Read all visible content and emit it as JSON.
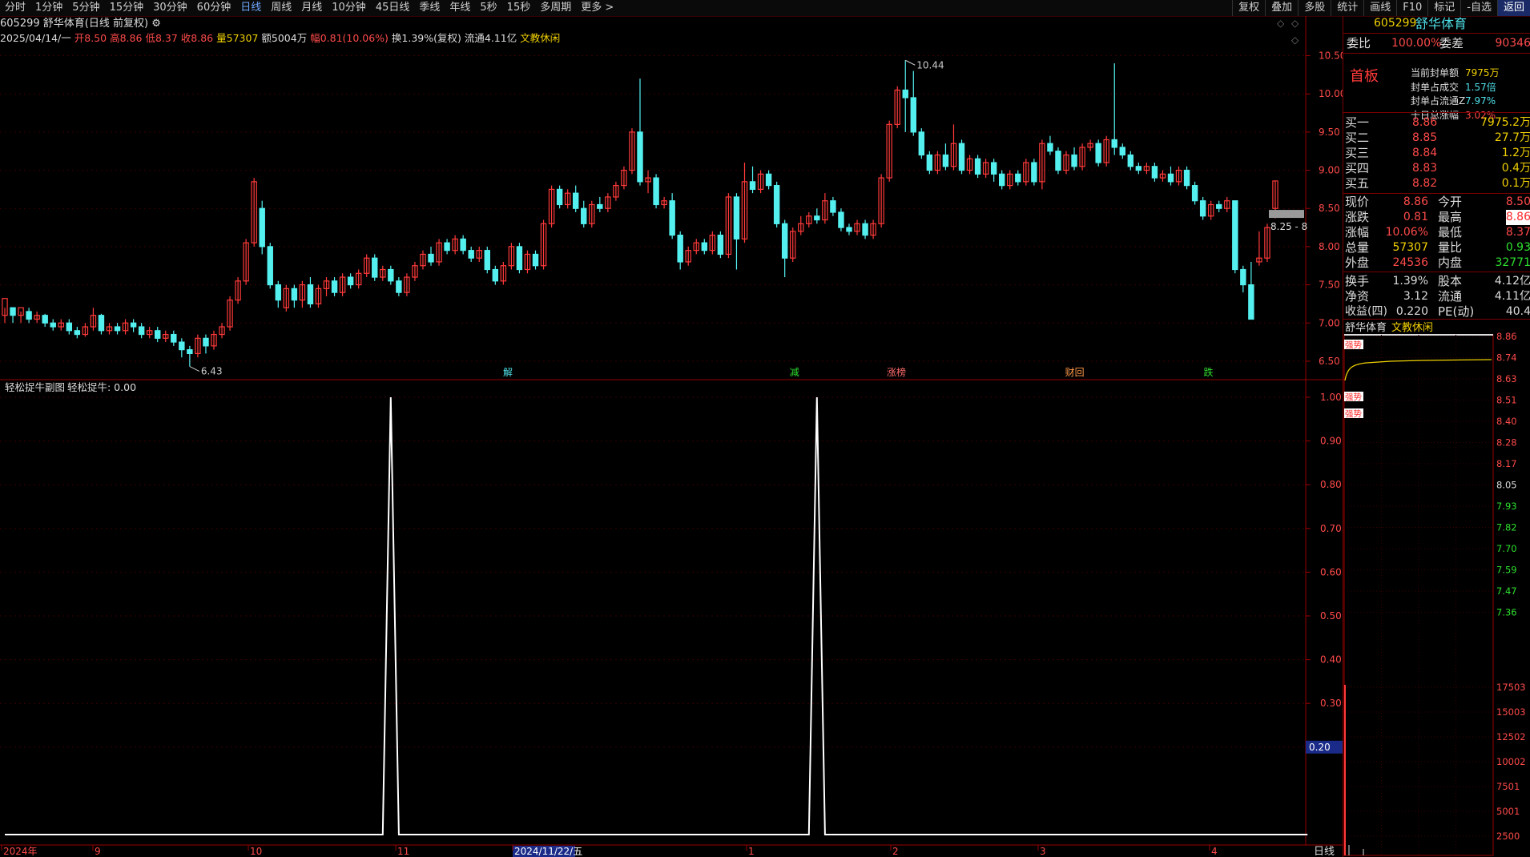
{
  "toolbar": {
    "periods": [
      "分时",
      "1分钟",
      "5分钟",
      "15分钟",
      "30分钟",
      "60分钟",
      "日线",
      "周线",
      "月线",
      "10分钟",
      "45日线",
      "季线",
      "年线",
      "5秒",
      "15秒",
      "多周期",
      "更多 >"
    ],
    "active_period": "日线",
    "tools": [
      "复权",
      "叠加",
      "多股",
      "统计",
      "画线",
      "F10",
      "标记",
      "-自选",
      "返回"
    ]
  },
  "chart_header": {
    "title_code": "605299",
    "title_name": "舒华体育(日线 前复权)",
    "date": "2025/04/14/一",
    "open_label": "开",
    "open": "8.50",
    "high_label": "高",
    "high": "8.86",
    "low_label": "低",
    "low": "8.37",
    "close_label": "收",
    "close": "8.86",
    "vol_label": "量",
    "vol": "57307",
    "amount": "额5004万",
    "change": "幅0.81(10.06%)",
    "turnover": "换1.39%(复权)",
    "float": "流通4.11亿",
    "sector": "文教休闲"
  },
  "chart_data": [
    {
      "type": "candlestick",
      "name": "main-kline",
      "ylim": [
        6.3,
        10.6
      ],
      "y_ticks": [
        "10.50",
        "10.00",
        "9.50",
        "9.00",
        "8.50",
        "8.00",
        "7.50",
        "7.00",
        "6.50"
      ],
      "annotations": {
        "high": "10.44",
        "low": "6.43",
        "last_box": "8.25 - 8"
      },
      "event_markers": [
        "解",
        "减",
        "涨榜",
        "财回",
        "跌"
      ],
      "candles": [
        [
          7.1,
          7.32,
          7.0,
          7.2
        ],
        [
          7.2,
          7.1,
          7.0,
          7.15
        ],
        [
          7.1,
          7.2,
          7.0,
          7.15
        ],
        [
          7.15,
          7.05,
          7.0,
          7.2
        ],
        [
          7.05,
          7.1,
          7.0,
          7.15
        ],
        [
          7.1,
          7.0,
          6.95,
          7.12
        ],
        [
          7.0,
          6.95,
          6.9,
          7.05
        ],
        [
          6.95,
          7.0,
          6.9,
          7.05
        ],
        [
          7.0,
          6.9,
          6.85,
          7.05
        ],
        [
          6.9,
          6.85,
          6.8,
          6.95
        ],
        [
          6.85,
          6.95,
          6.82,
          7.0
        ],
        [
          6.95,
          7.1,
          6.9,
          7.2
        ],
        [
          7.1,
          6.9,
          6.85,
          7.12
        ],
        [
          6.9,
          6.95,
          6.85,
          7.0
        ],
        [
          6.95,
          6.9,
          6.85,
          7.0
        ],
        [
          6.9,
          7.0,
          6.85,
          7.05
        ],
        [
          7.0,
          6.95,
          6.88,
          7.05
        ],
        [
          6.95,
          6.85,
          6.8,
          7.0
        ],
        [
          6.85,
          6.9,
          6.8,
          6.95
        ],
        [
          6.9,
          6.8,
          6.75,
          6.95
        ],
        [
          6.8,
          6.85,
          6.75,
          6.9
        ],
        [
          6.85,
          6.75,
          6.7,
          6.9
        ],
        [
          6.75,
          6.65,
          6.55,
          6.8
        ],
        [
          6.65,
          6.6,
          6.43,
          6.7
        ],
        [
          6.6,
          6.8,
          6.55,
          6.85
        ],
        [
          6.8,
          6.7,
          6.6,
          6.85
        ],
        [
          6.7,
          6.85,
          6.65,
          6.9
        ],
        [
          6.85,
          6.95,
          6.8,
          7.0
        ],
        [
          6.95,
          7.3,
          6.9,
          7.35
        ],
        [
          7.3,
          7.55,
          7.25,
          7.6
        ],
        [
          7.55,
          8.05,
          7.5,
          8.1
        ],
        [
          8.05,
          8.85,
          8.0,
          8.9
        ],
        [
          8.5,
          8.0,
          7.9,
          8.6
        ],
        [
          8.0,
          7.5,
          7.45,
          8.05
        ],
        [
          7.5,
          7.3,
          7.2,
          7.55
        ],
        [
          7.2,
          7.45,
          7.15,
          7.5
        ],
        [
          7.45,
          7.3,
          7.2,
          7.5
        ],
        [
          7.3,
          7.5,
          7.2,
          7.55
        ],
        [
          7.5,
          7.25,
          7.2,
          7.6
        ],
        [
          7.25,
          7.45,
          7.2,
          7.5
        ],
        [
          7.45,
          7.55,
          7.35,
          7.6
        ],
        [
          7.55,
          7.4,
          7.35,
          7.6
        ],
        [
          7.4,
          7.6,
          7.35,
          7.65
        ],
        [
          7.6,
          7.5,
          7.45,
          7.65
        ],
        [
          7.5,
          7.65,
          7.45,
          7.7
        ],
        [
          7.65,
          7.85,
          7.6,
          7.9
        ],
        [
          7.85,
          7.6,
          7.55,
          7.9
        ],
        [
          7.6,
          7.7,
          7.55,
          7.75
        ],
        [
          7.7,
          7.55,
          7.5,
          7.75
        ],
        [
          7.55,
          7.4,
          7.35,
          7.6
        ],
        [
          7.4,
          7.6,
          7.35,
          7.65
        ],
        [
          7.6,
          7.75,
          7.55,
          7.8
        ],
        [
          7.75,
          7.9,
          7.7,
          7.95
        ],
        [
          7.9,
          7.8,
          7.75,
          8.0
        ],
        [
          7.8,
          8.05,
          7.75,
          8.1
        ],
        [
          8.05,
          7.95,
          7.9,
          8.1
        ],
        [
          7.95,
          8.1,
          7.9,
          8.15
        ],
        [
          8.1,
          7.95,
          7.9,
          8.15
        ],
        [
          7.95,
          7.85,
          7.8,
          8.0
        ],
        [
          7.85,
          7.95,
          7.8,
          8.0
        ],
        [
          7.95,
          7.7,
          7.65,
          8.0
        ],
        [
          7.7,
          7.55,
          7.5,
          7.75
        ],
        [
          7.55,
          7.75,
          7.5,
          7.8
        ],
        [
          7.75,
          8.0,
          7.7,
          8.05
        ],
        [
          8.0,
          7.7,
          7.65,
          8.05
        ],
        [
          7.7,
          7.9,
          7.65,
          7.95
        ],
        [
          7.9,
          7.75,
          7.7,
          7.95
        ],
        [
          7.75,
          8.3,
          7.7,
          8.35
        ],
        [
          8.3,
          8.75,
          8.25,
          8.8
        ],
        [
          8.75,
          8.55,
          8.5,
          8.8
        ],
        [
          8.55,
          8.7,
          8.5,
          8.75
        ],
        [
          8.7,
          8.5,
          8.45,
          8.8
        ],
        [
          8.5,
          8.3,
          8.25,
          8.6
        ],
        [
          8.3,
          8.55,
          8.25,
          8.6
        ],
        [
          8.55,
          8.5,
          8.45,
          8.65
        ],
        [
          8.5,
          8.65,
          8.45,
          8.7
        ],
        [
          8.65,
          8.8,
          8.6,
          8.85
        ],
        [
          8.8,
          9.0,
          8.75,
          9.05
        ],
        [
          9.0,
          9.5,
          8.95,
          9.55
        ],
        [
          9.5,
          8.85,
          8.8,
          10.2
        ],
        [
          8.85,
          8.9,
          8.7,
          9.0
        ],
        [
          8.9,
          8.55,
          8.5,
          8.95
        ],
        [
          8.55,
          8.6,
          8.5,
          8.65
        ],
        [
          8.6,
          8.15,
          8.1,
          8.7
        ],
        [
          8.15,
          7.8,
          7.7,
          8.2
        ],
        [
          7.8,
          7.95,
          7.75,
          8.0
        ],
        [
          7.95,
          8.05,
          7.9,
          8.1
        ],
        [
          8.05,
          7.95,
          7.9,
          8.1
        ],
        [
          7.95,
          8.15,
          7.9,
          8.2
        ],
        [
          8.15,
          7.9,
          7.85,
          8.2
        ],
        [
          7.9,
          8.65,
          7.85,
          8.7
        ],
        [
          8.65,
          8.1,
          7.7,
          8.7
        ],
        [
          8.1,
          8.85,
          8.05,
          9.1
        ],
        [
          8.85,
          8.75,
          8.7,
          9.05
        ],
        [
          8.75,
          8.95,
          8.7,
          9.0
        ],
        [
          8.95,
          8.8,
          8.75,
          9.0
        ],
        [
          8.8,
          8.3,
          8.25,
          8.85
        ],
        [
          8.3,
          7.85,
          7.6,
          8.35
        ],
        [
          7.85,
          8.2,
          7.8,
          8.25
        ],
        [
          8.2,
          8.3,
          8.15,
          8.4
        ],
        [
          8.3,
          8.4,
          8.25,
          8.45
        ],
        [
          8.4,
          8.35,
          8.3,
          8.5
        ],
        [
          8.35,
          8.6,
          8.3,
          8.7
        ],
        [
          8.6,
          8.45,
          8.4,
          8.65
        ],
        [
          8.45,
          8.25,
          8.2,
          8.5
        ],
        [
          8.25,
          8.2,
          8.15,
          8.3
        ],
        [
          8.2,
          8.3,
          8.15,
          8.35
        ],
        [
          8.3,
          8.15,
          8.1,
          8.35
        ],
        [
          8.15,
          8.3,
          8.1,
          8.35
        ],
        [
          8.3,
          8.9,
          8.25,
          8.95
        ],
        [
          8.9,
          9.6,
          8.85,
          9.65
        ],
        [
          9.6,
          10.05,
          9.55,
          10.1
        ],
        [
          10.05,
          9.95,
          9.5,
          10.44
        ],
        [
          9.95,
          9.5,
          9.45,
          10.3
        ],
        [
          9.5,
          9.2,
          9.15,
          9.55
        ],
        [
          9.2,
          9.0,
          8.95,
          9.25
        ],
        [
          9.0,
          9.2,
          8.95,
          9.25
        ],
        [
          9.2,
          9.05,
          9.0,
          9.35
        ],
        [
          9.05,
          9.35,
          9.0,
          9.6
        ],
        [
          9.35,
          9.0,
          8.95,
          9.4
        ],
        [
          9.0,
          9.15,
          8.95,
          9.2
        ],
        [
          9.15,
          8.95,
          8.9,
          9.2
        ],
        [
          8.95,
          9.1,
          8.9,
          9.15
        ],
        [
          9.1,
          8.95,
          8.85,
          9.15
        ],
        [
          8.95,
          8.8,
          8.75,
          9.0
        ],
        [
          8.8,
          8.95,
          8.75,
          9.0
        ],
        [
          8.95,
          8.85,
          8.8,
          9.0
        ],
        [
          8.85,
          9.1,
          8.8,
          9.15
        ],
        [
          9.1,
          8.85,
          8.8,
          9.15
        ],
        [
          8.85,
          9.35,
          8.75,
          9.4
        ],
        [
          9.35,
          9.25,
          9.2,
          9.45
        ],
        [
          9.25,
          9.0,
          8.95,
          9.3
        ],
        [
          9.0,
          9.2,
          8.95,
          9.25
        ],
        [
          9.2,
          9.05,
          9.0,
          9.3
        ],
        [
          9.05,
          9.3,
          9.0,
          9.35
        ],
        [
          9.3,
          9.35,
          9.25,
          9.4
        ],
        [
          9.35,
          9.1,
          9.05,
          9.4
        ],
        [
          9.1,
          9.4,
          9.05,
          9.45
        ],
        [
          9.4,
          9.3,
          9.2,
          10.4
        ],
        [
          9.3,
          9.2,
          9.15,
          9.35
        ],
        [
          9.2,
          9.05,
          9.0,
          9.25
        ],
        [
          9.05,
          9.0,
          8.95,
          9.1
        ],
        [
          9.0,
          9.05,
          8.95,
          9.1
        ],
        [
          9.05,
          8.9,
          8.85,
          9.1
        ],
        [
          8.9,
          8.95,
          8.85,
          9.0
        ],
        [
          8.95,
          8.85,
          8.8,
          9.05
        ],
        [
          8.85,
          9.0,
          8.8,
          9.05
        ],
        [
          9.0,
          8.8,
          8.75,
          9.05
        ],
        [
          8.8,
          8.6,
          8.55,
          8.85
        ],
        [
          8.6,
          8.4,
          8.35,
          8.65
        ],
        [
          8.4,
          8.55,
          8.35,
          8.6
        ],
        [
          8.55,
          8.5,
          8.45,
          8.6
        ],
        [
          8.5,
          8.6,
          8.45,
          8.65
        ],
        [
          8.6,
          7.7,
          7.65,
          8.2
        ],
        [
          7.7,
          7.5,
          7.4,
          7.75
        ],
        [
          7.5,
          7.05,
          7.1,
          7.8
        ],
        [
          7.8,
          7.85,
          7.75,
          8.2
        ],
        [
          7.85,
          8.25,
          7.8,
          8.3
        ],
        [
          8.5,
          8.86,
          8.37,
          8.86
        ]
      ]
    },
    {
      "type": "line",
      "name": "sub-indicator",
      "title": "轻松捉牛副图",
      "series_label": "轻松捉牛: 0.00",
      "ylim": [
        0,
        1.0
      ],
      "y_ticks": [
        "1.00",
        "0.90",
        "0.80",
        "0.70",
        "0.60",
        "0.50",
        "0.40",
        "0.30",
        "0.20"
      ],
      "current_value": "0.20",
      "values": [
        0,
        0,
        0,
        0,
        0,
        0,
        0,
        0,
        0,
        0,
        0,
        0,
        0,
        0,
        0,
        0,
        0,
        0,
        0,
        0,
        0,
        0,
        0,
        0,
        0,
        0,
        0,
        0,
        0,
        0,
        0,
        0,
        0,
        0,
        0,
        0,
        0,
        0,
        0,
        0,
        0,
        0,
        0,
        0,
        0,
        0,
        0,
        0,
        0,
        0,
        0,
        0,
        0,
        0,
        0,
        0,
        0,
        0,
        0,
        0,
        0,
        0,
        0,
        0,
        0,
        0,
        0,
        0,
        0,
        0,
        0,
        0,
        0,
        0,
        0,
        0,
        0,
        0,
        0,
        0,
        0,
        0,
        0,
        0,
        0,
        0,
        0,
        0,
        0,
        0,
        0,
        0,
        0,
        0,
        0,
        0,
        0,
        0,
        0,
        0,
        0,
        0,
        0,
        0,
        0,
        0,
        0,
        0,
        0,
        0,
        0,
        0,
        0,
        0,
        0,
        0,
        0,
        0,
        0,
        0,
        0,
        0,
        0,
        0,
        0,
        0,
        0,
        0,
        0,
        0,
        0,
        0,
        0,
        0,
        0,
        0,
        0,
        0,
        0,
        0,
        0,
        0,
        0,
        0,
        0,
        0,
        0,
        0,
        0,
        0,
        0,
        0,
        0,
        0,
        0,
        0,
        0,
        0,
        0,
        0,
        0,
        0,
        0
      ],
      "spikes": [
        {
          "index": 48,
          "value": 1.0
        },
        {
          "index": 101,
          "value": 1.0
        }
      ]
    }
  ],
  "x_axis": {
    "labels": [
      "2024年",
      "9",
      "10",
      "11",
      "2024/11/22/五",
      "1",
      "2",
      "3",
      "4"
    ],
    "right_label": "日线"
  },
  "right_panel": {
    "code": "605299",
    "name": "舒华体育",
    "webi_label": "委比",
    "webi": "100.00%",
    "wecha_label": "委差",
    "wecha": "90346",
    "first_board": "首板",
    "seal_items": [
      {
        "label": "当前封单额",
        "value": "7975万"
      },
      {
        "label": "封单占成交",
        "value": "1.57倍"
      },
      {
        "label": "封单占流通Z",
        "value": "7.97%"
      },
      {
        "label": "十日总涨幅",
        "value": "3.02%"
      }
    ],
    "bids": [
      {
        "label": "买一",
        "price": "8.86",
        "vol": "7975.2万"
      },
      {
        "label": "买二",
        "price": "8.85",
        "vol": "27.7万"
      },
      {
        "label": "买三",
        "price": "8.84",
        "vol": "1.2万"
      },
      {
        "label": "买四",
        "price": "8.83",
        "vol": "0.4万"
      },
      {
        "label": "买五",
        "price": "8.82",
        "vol": "0.1万"
      }
    ],
    "quote": [
      {
        "l1": "现价",
        "v1": "8.86",
        "l2": "今开",
        "v2": "8.50",
        "c1": "red",
        "c2": "red"
      },
      {
        "l1": "涨跌",
        "v1": "0.81",
        "l2": "最高",
        "v2": "8.86",
        "c1": "red",
        "c2": "red"
      },
      {
        "l1": "涨幅",
        "v1": "10.06%",
        "l2": "最低",
        "v2": "8.37",
        "c1": "red",
        "c2": "red"
      },
      {
        "l1": "总量",
        "v1": "57307",
        "l2": "量比",
        "v2": "0.93",
        "c1": "yellow",
        "c2": "green"
      },
      {
        "l1": "外盘",
        "v1": "24536",
        "l2": "内盘",
        "v2": "32771",
        "c1": "red",
        "c2": "green"
      }
    ],
    "fund": [
      {
        "l1": "换手",
        "v1": "1.39%",
        "l2": "股本",
        "v2": "4.12亿"
      },
      {
        "l1": "净资",
        "v1": "3.12",
        "l2": "流通",
        "v2": "4.11亿"
      },
      {
        "l1": "收益(四)",
        "v1": "0.220",
        "l2": "PE(动)",
        "v2": "40.4"
      }
    ],
    "mini_title": "舒华体育",
    "mini_sector": "文教休闲",
    "mini_price_ticks": [
      "8.86",
      "8.74",
      "8.63",
      "8.51",
      "8.40",
      "8.28",
      "8.17",
      "8.05",
      "7.93",
      "7.82",
      "7.70",
      "7.59",
      "7.47",
      "7.36"
    ],
    "mini_vol_ticks": [
      "17503",
      "15003",
      "12502",
      "10002",
      "7501",
      "5001",
      "2500"
    ],
    "mini_tags": [
      "强势",
      "强势",
      "强势"
    ]
  }
}
